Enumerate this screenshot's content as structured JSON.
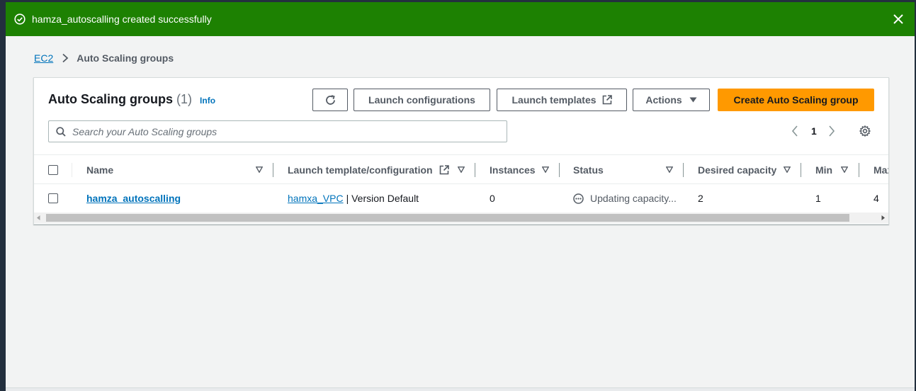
{
  "flash": {
    "message": "hamza_autoscalling created successfully",
    "type": "success",
    "color": "#1d8102",
    "icon": "check-circle-icon",
    "close_icon": "close-icon"
  },
  "breadcrumb": {
    "root": "EC2",
    "current": "Auto Scaling groups"
  },
  "panel": {
    "title": "Auto Scaling groups",
    "count": "(1)",
    "info": "Info"
  },
  "toolbar": {
    "refresh_icon": "refresh-icon",
    "launch_configurations": "Launch configurations",
    "launch_templates": "Launch templates",
    "actions": "Actions",
    "create": "Create Auto Scaling group",
    "primary_color": "#ff9900"
  },
  "search": {
    "placeholder": "Search your Auto Scaling groups"
  },
  "pagination": {
    "current_page": "1"
  },
  "table": {
    "columns": [
      "Name",
      "Launch template/configuration",
      "Instances",
      "Status",
      "Desired capacity",
      "Min",
      "Max"
    ],
    "rows": [
      {
        "name": "hamza_autoscalling",
        "launch_template": "hamxa_VPC",
        "launch_version": "| Version Default",
        "instances": "0",
        "status": "Updating capacity...",
        "desired": "2",
        "min": "1",
        "max": "4"
      }
    ]
  }
}
